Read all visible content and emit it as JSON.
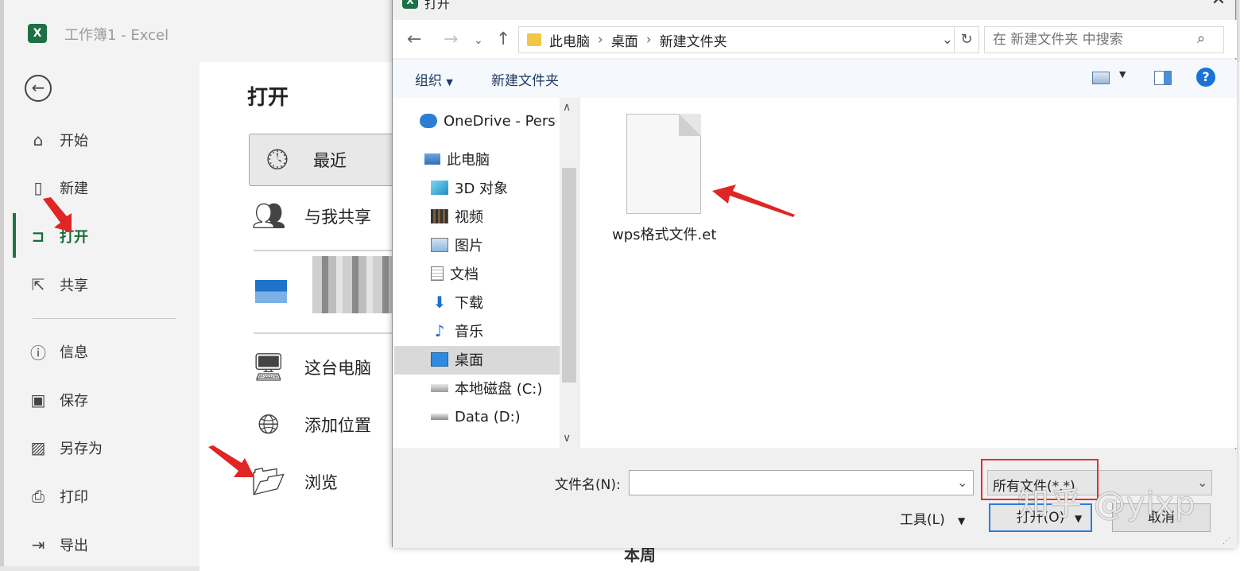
{
  "excel": {
    "title": "工作簿1  -  Excel",
    "logo": "X",
    "nav": [
      {
        "label": "开始",
        "icon": "home-icon"
      },
      {
        "label": "新建",
        "icon": "new-file-icon"
      },
      {
        "label": "打开",
        "icon": "open-folder-icon"
      },
      {
        "label": "共享",
        "icon": "share-icon"
      },
      {
        "label": "信息",
        "icon": "info-icon"
      },
      {
        "label": "保存",
        "icon": "save-icon"
      },
      {
        "label": "另存为",
        "icon": "save-as-icon"
      },
      {
        "label": "打印",
        "icon": "print-icon"
      },
      {
        "label": "导出",
        "icon": "export-icon"
      }
    ],
    "open_heading": "打开",
    "locations": [
      {
        "label": "最近",
        "icon": "clock-icon"
      },
      {
        "label": "与我共享",
        "icon": "people-icon"
      },
      {
        "label": "这台电脑",
        "icon": "computer-icon"
      },
      {
        "label": "添加位置",
        "icon": "globe-add-icon"
      },
      {
        "label": "浏览",
        "icon": "folder-open-icon"
      }
    ],
    "section_label": "本周",
    "accent": "#217346"
  },
  "dialog": {
    "title": "打开",
    "breadcrumb": [
      "此电脑",
      "桌面",
      "新建文件夹"
    ],
    "search_placeholder": "在 新建文件夹 中搜索",
    "toolbar": {
      "organize": "组织",
      "new_folder": "新建文件夹"
    },
    "tree": [
      {
        "label": "OneDrive - Perso",
        "icon": "cloud-icon"
      },
      {
        "label": "此电脑",
        "icon": "pc-icon"
      },
      {
        "label": "3D 对象",
        "icon": "cube-icon"
      },
      {
        "label": "视频",
        "icon": "video-icon"
      },
      {
        "label": "图片",
        "icon": "picture-icon"
      },
      {
        "label": "文档",
        "icon": "document-icon"
      },
      {
        "label": "下载",
        "icon": "download-icon"
      },
      {
        "label": "音乐",
        "icon": "music-icon"
      },
      {
        "label": "桌面",
        "icon": "desktop-icon"
      },
      {
        "label": "本地磁盘 (C:)",
        "icon": "drive-icon"
      },
      {
        "label": "Data (D:)",
        "icon": "drive-icon"
      }
    ],
    "selected_tree_item": "桌面",
    "files": [
      {
        "name": "wps格式文件.et",
        "icon": "blank-file-icon"
      }
    ],
    "filename_label": "文件名(N):",
    "filename_value": "",
    "filter": "所有文件(*.*)",
    "tools_label": "工具(L)",
    "open_button": "打开(O)",
    "cancel_button": "取消",
    "highlight_color": "#e03030"
  },
  "watermark": "知乎 @yixp"
}
